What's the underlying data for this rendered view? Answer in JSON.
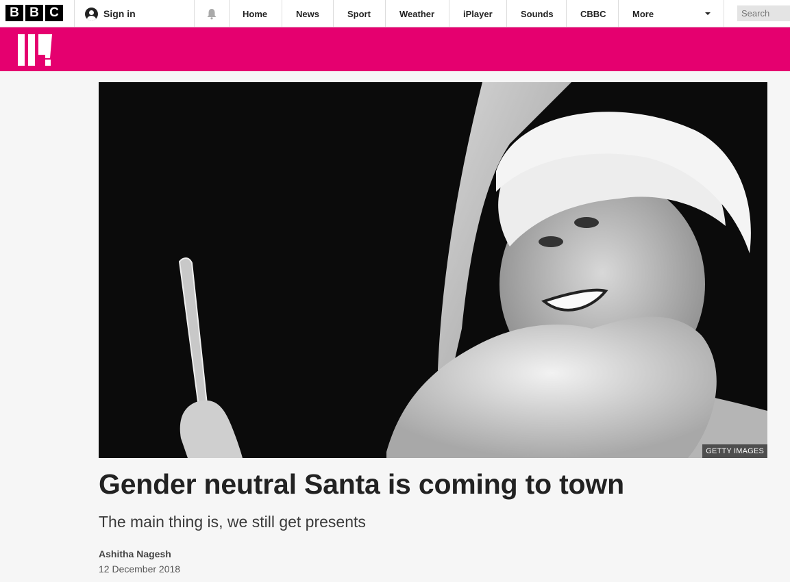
{
  "header": {
    "logo_letters": [
      "B",
      "B",
      "C"
    ],
    "signin_label": "Sign in",
    "nav": [
      "Home",
      "News",
      "Sport",
      "Weather",
      "iPlayer",
      "Sounds",
      "CBBC",
      "More"
    ],
    "search_placeholder": "Search"
  },
  "brand": {
    "color": "#e5006f"
  },
  "article": {
    "image_credit": "GETTY IMAGES",
    "headline": "Gender neutral Santa is coming to town",
    "standfirst": "The main thing is, we still get presents",
    "author": "Ashitha Nagesh",
    "date": "12 December 2018"
  }
}
